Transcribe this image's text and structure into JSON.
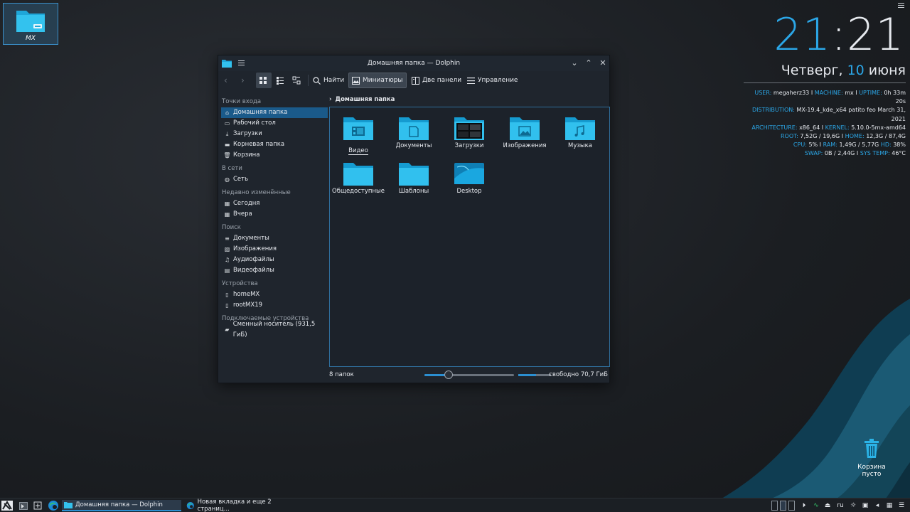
{
  "desktop": {
    "mx_icon_label": "MX",
    "trash_label_1": "Корзина",
    "trash_label_2": "пусто"
  },
  "conky": {
    "hours": "21",
    "colon": ":",
    "minutes": "21",
    "weekday": "Четверг,",
    "day": "10",
    "month": "июня",
    "lines": [
      [
        [
          "k",
          "USER: "
        ],
        [
          "v",
          "megaherz33 "
        ],
        [
          "v",
          "I "
        ],
        [
          "k",
          "MACHINE: "
        ],
        [
          "v",
          "mx "
        ],
        [
          "v",
          "I "
        ],
        [
          "k",
          "UPTIME: "
        ],
        [
          "v",
          "0h 33m 20s"
        ]
      ],
      [
        [
          "k",
          "DISTRIBUTION: "
        ],
        [
          "v",
          "MX-19.4_kde_x64 patito feo March 31, 2021"
        ]
      ],
      [
        [
          "k",
          "ARCHITECTURE: "
        ],
        [
          "v",
          "x86_64 "
        ],
        [
          "v",
          "I "
        ],
        [
          "k",
          "KERNEL: "
        ],
        [
          "v",
          "5.10.0-5mx-amd64"
        ]
      ],
      [
        [
          "k",
          "ROOT: "
        ],
        [
          "v",
          "7,52G / 19,6G "
        ],
        [
          "v",
          "I "
        ],
        [
          "k",
          "HOME: "
        ],
        [
          "v",
          "12,3G / 87,4G"
        ]
      ],
      [
        [
          "k",
          "CPU: "
        ],
        [
          "v",
          "5% "
        ],
        [
          "v",
          "I "
        ],
        [
          "k",
          "RAM: "
        ],
        [
          "v",
          "1,49G / 5,77G "
        ],
        [
          "k",
          "HD: "
        ],
        [
          "v",
          "38%"
        ]
      ],
      [
        [
          "k",
          "SWAP: "
        ],
        [
          "v",
          "0B / 2,44G "
        ],
        [
          "v",
          "I "
        ],
        [
          "k",
          "SYS TEMP: "
        ],
        [
          "v",
          "46°C"
        ]
      ]
    ]
  },
  "window": {
    "title": "Домашняя папка — Dolphin",
    "toolbar": {
      "find": "Найти",
      "previews": "Миниатюры",
      "split": "Две панели",
      "control": "Управление"
    },
    "sidebar": [
      {
        "section": "Точки входа",
        "items": [
          {
            "label": "Домашняя папка",
            "icon": "home-icon",
            "glyph": "⌂",
            "active": true
          },
          {
            "label": "Рабочий стол",
            "icon": "desktop-icon",
            "glyph": "▭"
          },
          {
            "label": "Загрузки",
            "icon": "download-icon",
            "glyph": "⤓"
          },
          {
            "label": "Корневая папка",
            "icon": "folder-red-icon",
            "glyph": "▬"
          },
          {
            "label": "Корзина",
            "icon": "trash-icon",
            "glyph": "🗑"
          }
        ]
      },
      {
        "section": "В сети",
        "items": [
          {
            "label": "Сеть",
            "icon": "network-icon",
            "glyph": "◍"
          }
        ]
      },
      {
        "section": "Недавно изменённые",
        "items": [
          {
            "label": "Сегодня",
            "icon": "calendar-icon",
            "glyph": "▦"
          },
          {
            "label": "Вчера",
            "icon": "calendar-icon",
            "glyph": "▦"
          }
        ]
      },
      {
        "section": "Поиск",
        "items": [
          {
            "label": "Документы",
            "icon": "document-icon",
            "glyph": "≡"
          },
          {
            "label": "Изображения",
            "icon": "image-icon",
            "glyph": "▨"
          },
          {
            "label": "Аудиофайлы",
            "icon": "music-icon",
            "glyph": "♫"
          },
          {
            "label": "Видеофайлы",
            "icon": "video-icon",
            "glyph": "▤"
          }
        ]
      },
      {
        "section": "Устройства",
        "items": [
          {
            "label": "homeMX",
            "icon": "drive-icon",
            "glyph": "▯"
          },
          {
            "label": "rootMX19",
            "icon": "drive-icon",
            "glyph": "▯"
          }
        ]
      },
      {
        "section": "Подключаемые устройства",
        "items": [
          {
            "label": "Сменный носитель (931,5 ГиБ)",
            "icon": "usb-drive-icon",
            "glyph": "▰"
          }
        ]
      }
    ],
    "breadcrumb": "Домашняя папка",
    "tiles": [
      {
        "name": "Видео",
        "emblem": "film",
        "selected": true
      },
      {
        "name": "Документы",
        "emblem": "doc"
      },
      {
        "name": "Загрузки",
        "emblem": "thumb"
      },
      {
        "name": "Изображения",
        "emblem": "image"
      },
      {
        "name": "Музыка",
        "emblem": "music"
      },
      {
        "name": "Общедоступные",
        "emblem": "none"
      },
      {
        "name": "Шаблоны",
        "emblem": "none"
      },
      {
        "name": "Desktop",
        "emblem": "desktop"
      }
    ],
    "status_left": "8 папок",
    "zoom_fraction": 0.27,
    "free_fraction": 0.55,
    "status_right": "свободно 70,7 ГиБ"
  },
  "taskbar": {
    "task1": "Домашняя папка — Dolphin",
    "task2": "Новая вкладка и еще 2 страниц...",
    "lang": "ru"
  }
}
